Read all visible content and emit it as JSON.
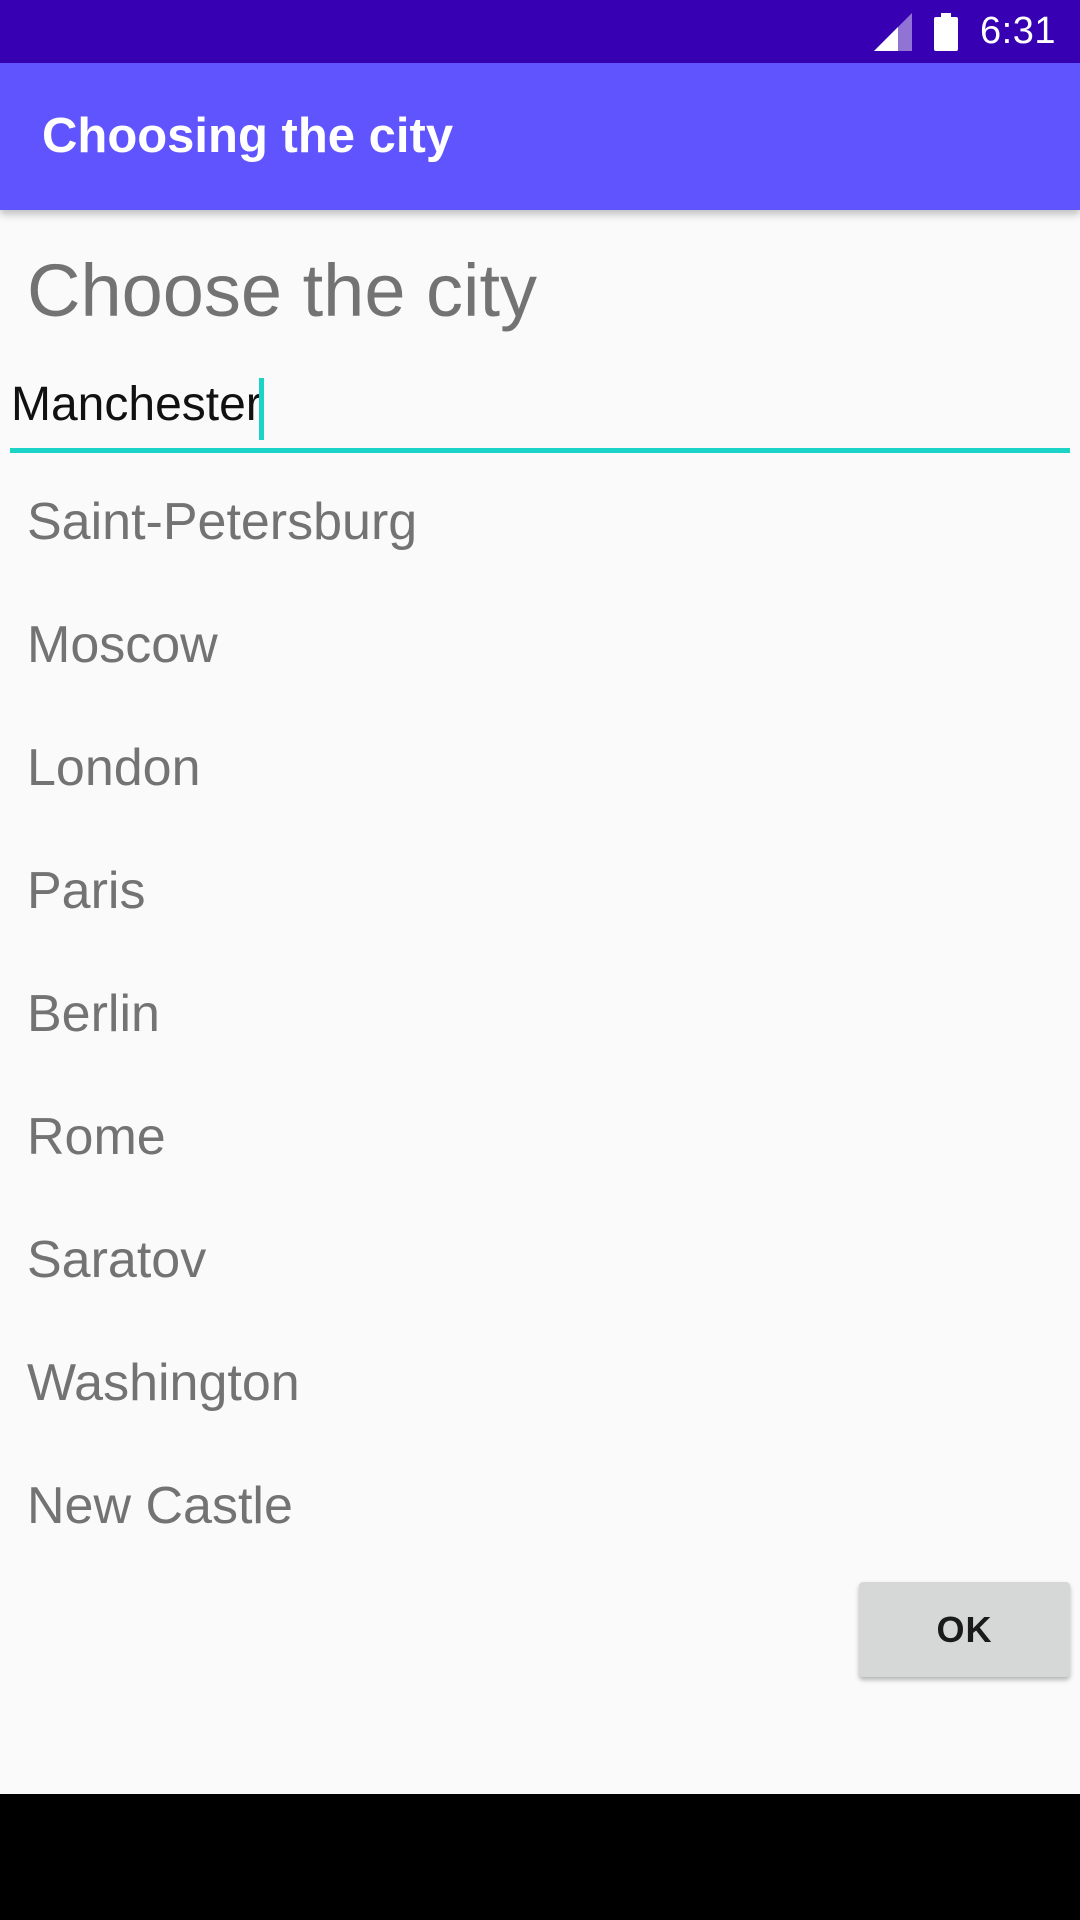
{
  "status_bar": {
    "time": "6:31",
    "icons": [
      "signal-icon",
      "battery-icon"
    ]
  },
  "app_bar": {
    "title": "Choosing the city"
  },
  "main": {
    "heading": "Choose the city",
    "city_input": {
      "value": "Manchester"
    },
    "cities": [
      "Saint-Petersburg",
      "Moscow",
      "London",
      "Paris",
      "Berlin",
      "Rome",
      "Saratov",
      "Washington",
      "New Castle"
    ],
    "ok_label": "OK"
  },
  "colors": {
    "status_bar": "#3700b3",
    "app_bar": "#6054ff",
    "accent": "#1bd3c6",
    "background": "#fafafa",
    "button": "#d6d7d7"
  }
}
